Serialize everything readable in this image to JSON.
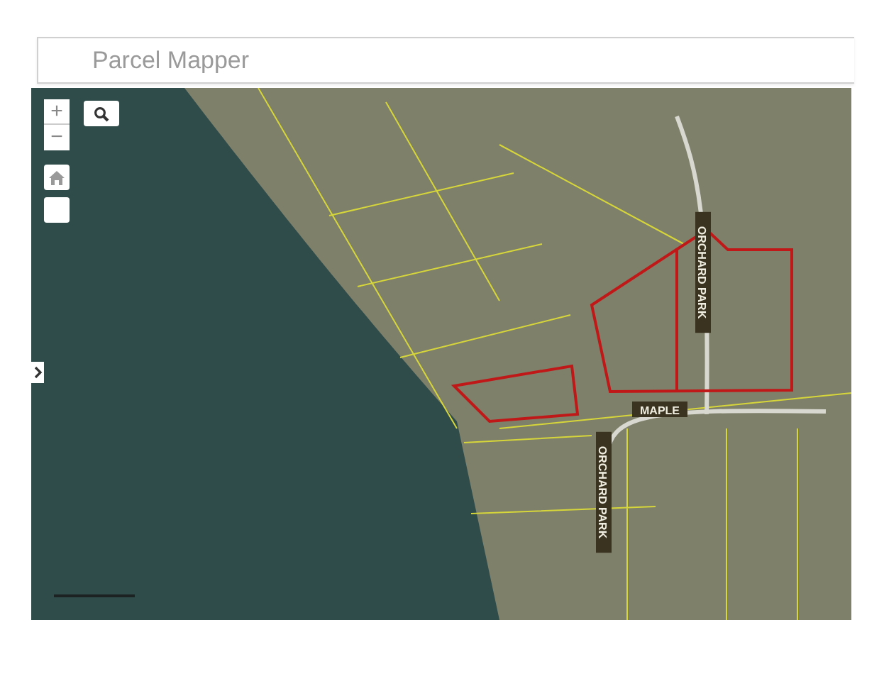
{
  "header": {
    "title": "Parcel Mapper"
  },
  "map_controls": [
    {
      "kind": "zoom-in",
      "label": "+"
    },
    {
      "kind": "zoom-out",
      "label": "−"
    }
  ],
  "map": {
    "street_labels": [
      {
        "text": "MAPLE",
        "rotated": false
      },
      {
        "text": "ORCHARD PARK",
        "rotated": true
      },
      {
        "text": "ORCHARD PARK",
        "rotated": true
      }
    ]
  }
}
